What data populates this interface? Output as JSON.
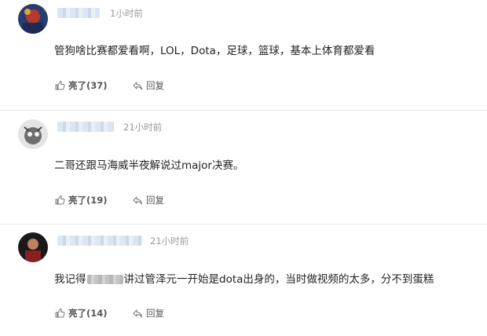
{
  "comments": [
    {
      "time": "1小时前",
      "text": "管狗啥比赛都爱看啊，LOL，Dota，足球，篮球，基本上体育都爱看",
      "like_label": "亮了",
      "like_count": "(37)",
      "reply_label": "回复"
    },
    {
      "time": "21小时前",
      "text": "二哥还跟马海威半夜解说过major决赛。",
      "like_label": "亮了",
      "like_count": "(19)",
      "reply_label": "回复"
    },
    {
      "time": "21小时前",
      "text_before": "我记得",
      "text_after": "讲过管泽元一开始是dota出身的，当时做视频的太多，分不到蛋糕",
      "like_label": "亮了",
      "like_count": "(14)",
      "reply_label": "回复"
    }
  ],
  "icons": {
    "like": "thumbs-up-icon",
    "reply": "reply-arrow-icon"
  },
  "colors": {
    "text": "#222222",
    "meta": "#999999",
    "action": "#555555",
    "divider": "#e8e8e8"
  }
}
